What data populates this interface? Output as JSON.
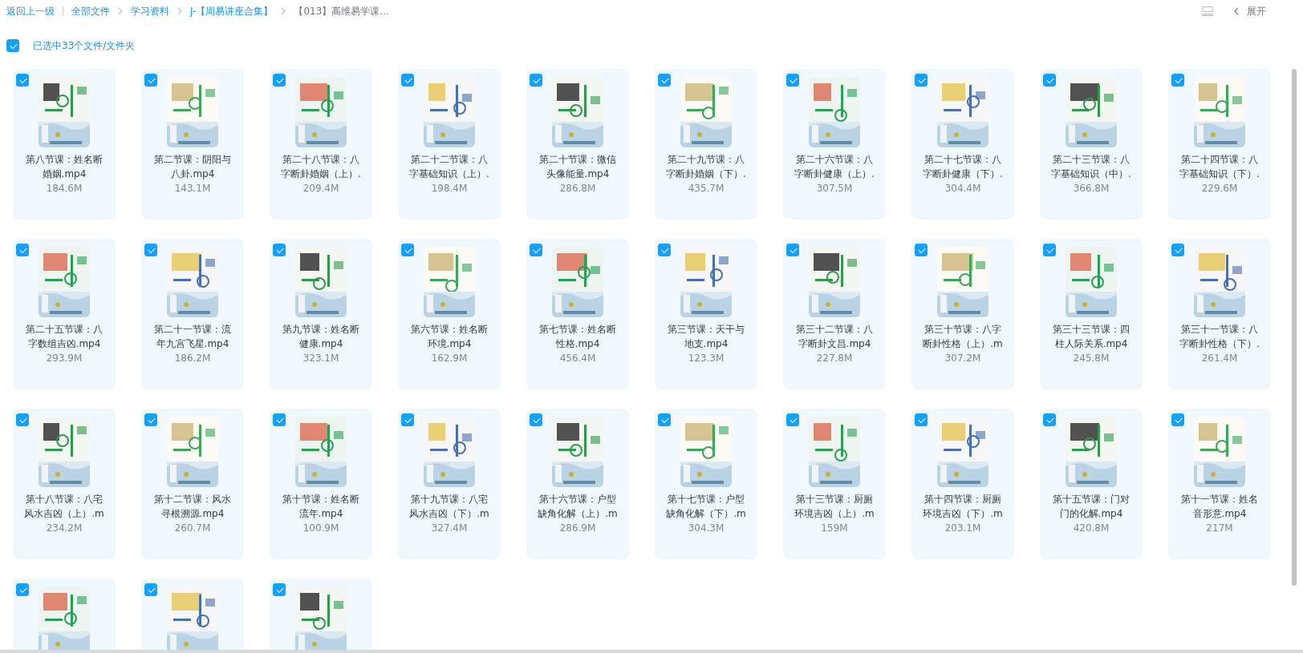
{
  "breadcrumbs": [
    {
      "label": "返回上一级",
      "kind": "back"
    },
    {
      "label": "全部文件",
      "kind": "link"
    },
    {
      "label": "学习资料",
      "kind": "link"
    },
    {
      "label": "J-【周易讲座合集】",
      "kind": "link"
    },
    {
      "label": "【013】高维易学课...",
      "kind": "current"
    }
  ],
  "toolbar": {
    "expand_label": "展开"
  },
  "selection": {
    "checked": true,
    "label": "已选中33个文件/文件夹"
  },
  "files": [
    {
      "name": "第八节课：姓名断婚姻.mp4",
      "size": "184.6M",
      "checked": true
    },
    {
      "name": "第二节课：阴阳与八卦.mp4",
      "size": "143.1M",
      "checked": true
    },
    {
      "name": "第二十八节课：八字断卦婚姻（上）.",
      "size": "209.4M",
      "checked": true
    },
    {
      "name": "第二十二节课：八字基础知识（上）.",
      "size": "198.4M",
      "checked": true
    },
    {
      "name": "第二十节课：微信头像能量.mp4",
      "size": "286.8M",
      "checked": true
    },
    {
      "name": "第二十九节课：八字断卦婚姻（下）.",
      "size": "435.7M",
      "checked": true
    },
    {
      "name": "第二十六节课：八字断卦健康（上）.",
      "size": "307.5M",
      "checked": true
    },
    {
      "name": "第二十七节课：八字断卦健康（下）.",
      "size": "304.4M",
      "checked": true
    },
    {
      "name": "第二十三节课：八字基础知识（中）.",
      "size": "366.8M",
      "checked": true
    },
    {
      "name": "第二十四节课：八字基础知识（下）.",
      "size": "229.6M",
      "checked": true
    },
    {
      "name": "第二十五节课：八字数组吉凶.mp4",
      "size": "293.9M",
      "checked": true
    },
    {
      "name": "第二十一节课：流年九宫飞星.mp4",
      "size": "186.2M",
      "checked": true
    },
    {
      "name": "第九节课：姓名断健康.mp4",
      "size": "323.1M",
      "checked": true
    },
    {
      "name": "第六节课：姓名断环境.mp4",
      "size": "162.9M",
      "checked": true
    },
    {
      "name": "第七节课：姓名断性格.mp4",
      "size": "456.4M",
      "checked": true
    },
    {
      "name": "第三节课：天干与地支.mp4",
      "size": "123.3M",
      "checked": true
    },
    {
      "name": "第三十二节课：八字断卦文昌.mp4",
      "size": "227.8M",
      "checked": true
    },
    {
      "name": "第三十节课：八字断卦性格（上）.m",
      "size": "307.2M",
      "checked": true
    },
    {
      "name": "第三十三节课：四柱人际关系.mp4",
      "size": "245.8M",
      "checked": true
    },
    {
      "name": "第三十一节课：八字断卦性格（下）.",
      "size": "261.4M",
      "checked": true
    },
    {
      "name": "第十八节课：八宅风水吉凶（上）.m",
      "size": "234.2M",
      "checked": true
    },
    {
      "name": "第十二节课：风水寻根溯源.mp4",
      "size": "260.7M",
      "checked": true
    },
    {
      "name": "第十节课：姓名断流年.mp4",
      "size": "100.9M",
      "checked": true
    },
    {
      "name": "第十九节课：八宅风水吉凶（下）.m",
      "size": "327.4M",
      "checked": true
    },
    {
      "name": "第十六节课：户型缺角化解（上）.m",
      "size": "286.9M",
      "checked": true
    },
    {
      "name": "第十七节课：户型缺角化解（下）.m",
      "size": "304.3M",
      "checked": true
    },
    {
      "name": "第十三节课：厨厕环境吉凶（上）.m",
      "size": "159M",
      "checked": true
    },
    {
      "name": "第十四节课：厨厕环境吉凶（下）.m",
      "size": "203.1M",
      "checked": true
    },
    {
      "name": "第十五节课：门对门的化解.mp4",
      "size": "420.8M",
      "checked": true
    },
    {
      "name": "第十一节课：姓名音形意.mp4",
      "size": "217M",
      "checked": true
    },
    {
      "checked": true
    },
    {
      "checked": true
    },
    {
      "checked": true
    }
  ]
}
